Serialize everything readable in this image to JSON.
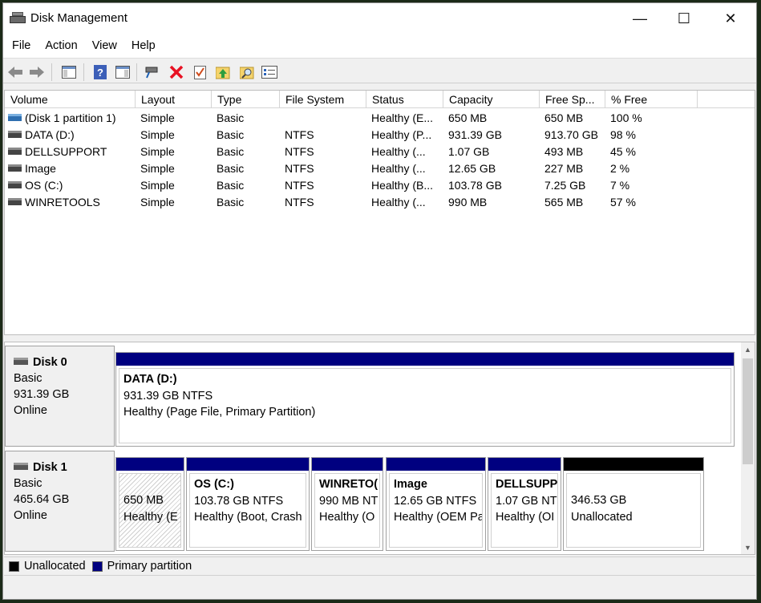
{
  "window": {
    "title": "Disk Management",
    "controls": {
      "minimize": "—",
      "maximize": "☐",
      "close": "✕"
    }
  },
  "menu": [
    "File",
    "Action",
    "View",
    "Help"
  ],
  "toolbar": {
    "icons": [
      "back-arrow-icon",
      "forward-arrow-icon",
      "show-hide-console-tree-icon",
      "help-icon",
      "properties-view-icon",
      "connect-disk-icon",
      "delete-icon",
      "check-properties-icon",
      "refresh-folder-icon",
      "search-folder-icon",
      "settings-list-icon"
    ],
    "delete_color": "#e81123"
  },
  "volume_table": {
    "columns": [
      "Volume",
      "Layout",
      "Type",
      "File System",
      "Status",
      "Capacity",
      "Free Sp...",
      "% Free"
    ],
    "rows": [
      {
        "volume": "(Disk 1 partition 1)",
        "layout": "Simple",
        "type": "Basic",
        "fs": "",
        "status": "Healthy (E...",
        "capacity": "650 MB",
        "free": "650 MB",
        "pct": "100 %"
      },
      {
        "volume": "DATA (D:)",
        "layout": "Simple",
        "type": "Basic",
        "fs": "NTFS",
        "status": "Healthy (P...",
        "capacity": "931.39 GB",
        "free": "913.70 GB",
        "pct": "98 %"
      },
      {
        "volume": "DELLSUPPORT",
        "layout": "Simple",
        "type": "Basic",
        "fs": "NTFS",
        "status": "Healthy (...",
        "capacity": "1.07 GB",
        "free": "493 MB",
        "pct": "45 %"
      },
      {
        "volume": "Image",
        "layout": "Simple",
        "type": "Basic",
        "fs": "NTFS",
        "status": "Healthy (...",
        "capacity": "12.65 GB",
        "free": "227 MB",
        "pct": "2 %"
      },
      {
        "volume": "OS (C:)",
        "layout": "Simple",
        "type": "Basic",
        "fs": "NTFS",
        "status": "Healthy (B...",
        "capacity": "103.78 GB",
        "free": "7.25 GB",
        "pct": "7 %"
      },
      {
        "volume": "WINRETOOLS",
        "layout": "Simple",
        "type": "Basic",
        "fs": "NTFS",
        "status": "Healthy (...",
        "capacity": "990 MB",
        "free": "565 MB",
        "pct": "57 %"
      }
    ]
  },
  "disks": [
    {
      "name": "Disk 0",
      "kind": "Basic",
      "size": "931.39 GB",
      "state": "Online",
      "partitions": [
        {
          "title": "DATA  (D:)",
          "line1": "931.39 GB NTFS",
          "line2": "Healthy (Page File, Primary Partition)"
        }
      ]
    },
    {
      "name": "Disk 1",
      "kind": "Basic",
      "size": "465.64 GB",
      "state": "Online",
      "partitions": [
        {
          "title": "",
          "line1": "650 MB",
          "line2": "Healthy (E"
        },
        {
          "title": "OS  (C:)",
          "line1": "103.78 GB NTFS",
          "line2": "Healthy (Boot, Crash"
        },
        {
          "title": "WINRETO(",
          "line1": "990 MB NT",
          "line2": "Healthy (O"
        },
        {
          "title": "Image",
          "line1": "12.65 GB NTFS",
          "line2": "Healthy (OEM Pa"
        },
        {
          "title": "DELLSUPP(",
          "line1": "1.07 GB NT",
          "line2": "Healthy (OI"
        },
        {
          "title": "",
          "line1": "346.53 GB",
          "line2": "Unallocated"
        }
      ]
    }
  ],
  "legend": {
    "unallocated": "Unallocated",
    "primary": "Primary partition",
    "unallocated_color": "#000000",
    "primary_color": "#000080"
  }
}
